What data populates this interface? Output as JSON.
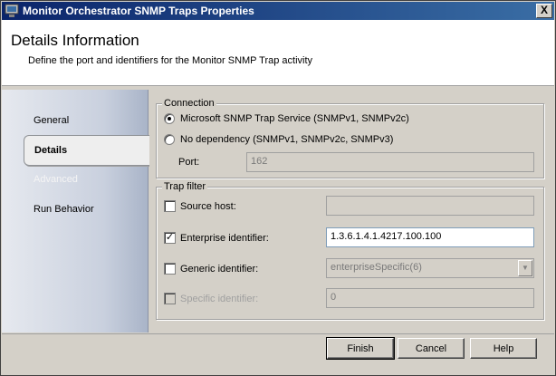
{
  "window": {
    "title": "Monitor Orchestrator SNMP Traps Properties",
    "close_symbol": "X"
  },
  "header": {
    "title": "Details Information",
    "subtitle": "Define the port and identifiers for the Monitor SNMP Trap activity"
  },
  "nav": {
    "items": [
      {
        "label": "General",
        "state": "normal"
      },
      {
        "label": "Details",
        "state": "selected"
      },
      {
        "label": "Advanced",
        "state": "disabled"
      },
      {
        "label": "Run Behavior",
        "state": "normal"
      }
    ]
  },
  "connection": {
    "legend": "Connection",
    "option1": "Microsoft SNMP Trap Service (SNMPv1, SNMPv2c)",
    "option2": "No dependency (SNMPv1, SNMPv2c, SNMPv3)",
    "port_label": "Port:",
    "port_value": "162"
  },
  "trap_filter": {
    "legend": "Trap filter",
    "source_host_label": "Source host:",
    "source_host_value": "",
    "enterprise_label": "Enterprise identifier:",
    "enterprise_value": "1.3.6.1.4.1.4217.100.100",
    "generic_label": "Generic identifier:",
    "generic_value": "enterpriseSpecific(6)",
    "specific_label": "Specific identifier:",
    "specific_value": "0",
    "check_mark": "✓"
  },
  "buttons": {
    "finish": "Finish",
    "cancel": "Cancel",
    "help": "Help"
  }
}
